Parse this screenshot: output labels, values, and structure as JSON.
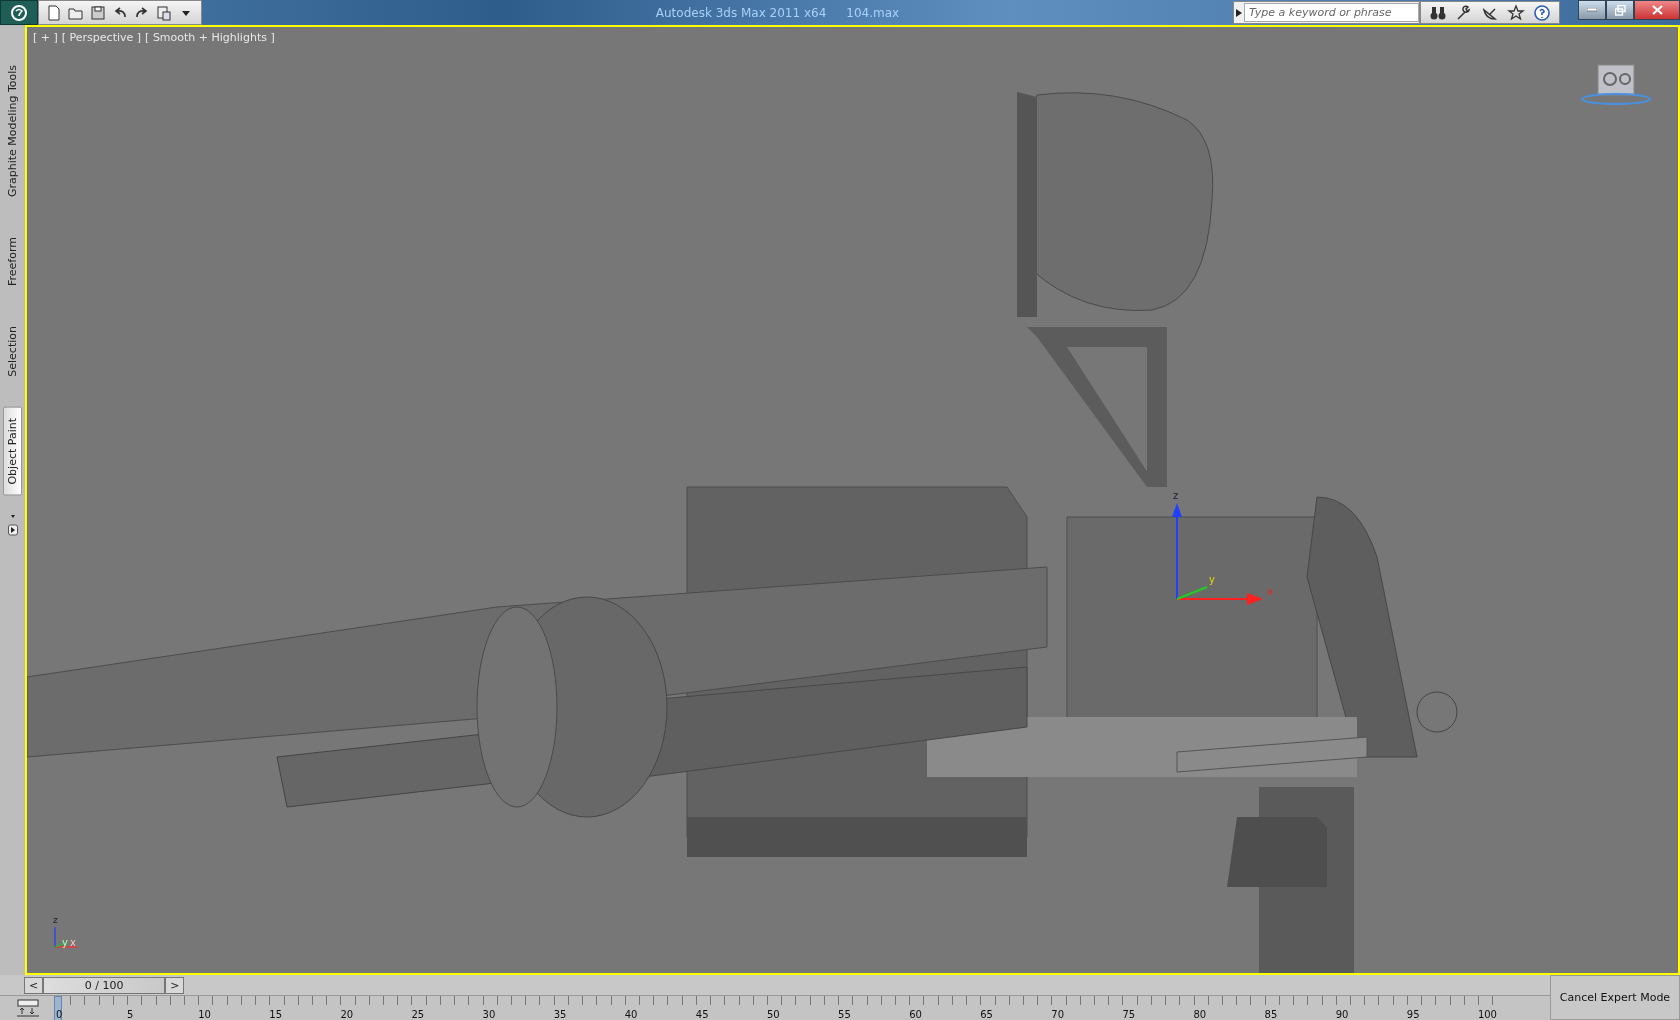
{
  "title_bar": {
    "app_title": "Autodesk 3ds Max  2011 x64",
    "file_name": "104.max",
    "search": {
      "placeholder": "Type a keyword or phrase"
    }
  },
  "ribbon_tabs": [
    {
      "label": "Graphite Modeling Tools",
      "selected": false
    },
    {
      "label": "Freeform",
      "selected": false
    },
    {
      "label": "Selection",
      "selected": false
    },
    {
      "label": "Object Paint",
      "selected": true
    }
  ],
  "viewport": {
    "labels": [
      "[ + ]",
      "[ Perspective ]",
      "[ Smooth + Highlights ]"
    ],
    "gizmo_axes": [
      "z",
      "y",
      "x"
    ],
    "corner_axes": [
      "z",
      "y",
      "x"
    ]
  },
  "time_slider": {
    "prev": "<",
    "position": "0 / 100",
    "next": ">"
  },
  "track_bar": {
    "ticks": [
      "0",
      "5",
      "10",
      "15",
      "20",
      "25",
      "30",
      "35",
      "40",
      "45",
      "50",
      "55",
      "60",
      "65",
      "70",
      "75",
      "80",
      "85",
      "90",
      "95",
      "100"
    ]
  },
  "cancel_button": "Cancel Expert Mode"
}
